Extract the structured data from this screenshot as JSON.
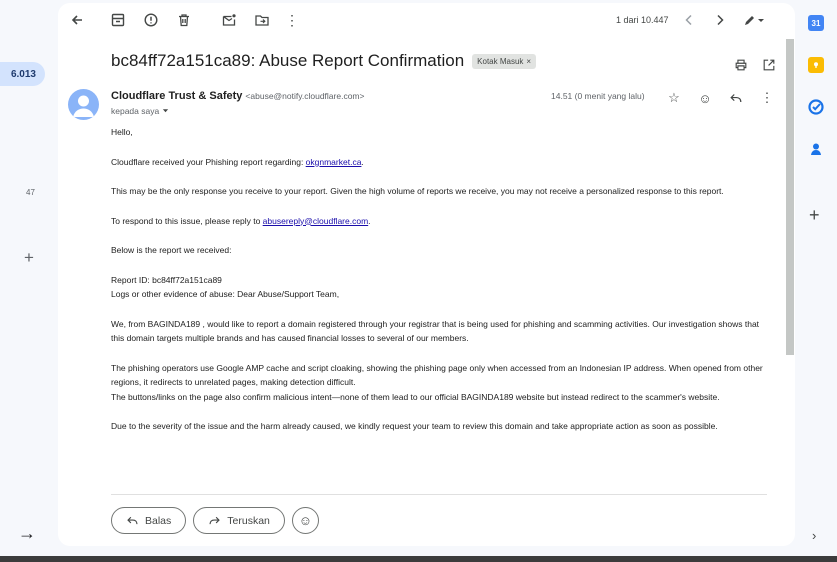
{
  "left_rail": {
    "inbox_count": "6.013",
    "other_count": "47"
  },
  "toolbar": {
    "pager_text": "1 dari 10.447"
  },
  "email": {
    "subject": "bc84ff72a151ca89: Abuse Report Confirmation",
    "label": "Kotak Masuk",
    "sender_name": "Cloudflare Trust & Safety",
    "sender_email": "<abuse@notify.cloudflare.com>",
    "to_text": "kepada saya",
    "time": "14.51 (0 menit yang lalu)",
    "greeting": "Hello,",
    "p1_prefix": "Cloudflare received your Phishing report regarding: ",
    "p1_link": "okgnmarket.ca",
    "p1_suffix": ".",
    "p2": "This may be the only response you receive to your report. Given the high volume of reports we receive, you may not receive a personalized response to this report.",
    "p3_prefix": "To respond to this issue, please reply to ",
    "p3_link": "abusereply@cloudflare.com",
    "p3_suffix": ".",
    "p4": "Below is the report we received:",
    "report_id": "Report ID: bc84ff72a151ca89",
    "evidence": "Logs or other evidence of abuse:  Dear Abuse/Support Team,",
    "p5": "We, from BAGINDA189 , would like to report a domain registered through your registrar that is being used for phishing and scamming activities. Our investigation shows that this domain targets multiple brands and has caused financial losses to several of our members.",
    "p6a": "The phishing operators use Google AMP cache and script cloaking, showing the phishing page only when accessed from an Indonesian IP address. When opened from other regions, it redirects to unrelated pages, making detection difficult.",
    "p6b": "The buttons/links on the page also confirm malicious intent—none of them lead to our official BAGINDA189 website but instead redirect to the scammer's website.",
    "p7": "Due to the severity of the issue and the harm already caused, we kindly request your team to review this domain and take appropriate action as soon as possible."
  },
  "reply_bar": {
    "reply_label": "Balas",
    "forward_label": "Teruskan"
  },
  "colors": {
    "accent": "#0b57d0",
    "pill_bg": "#d3e3fd",
    "link": "#1a0dab"
  }
}
